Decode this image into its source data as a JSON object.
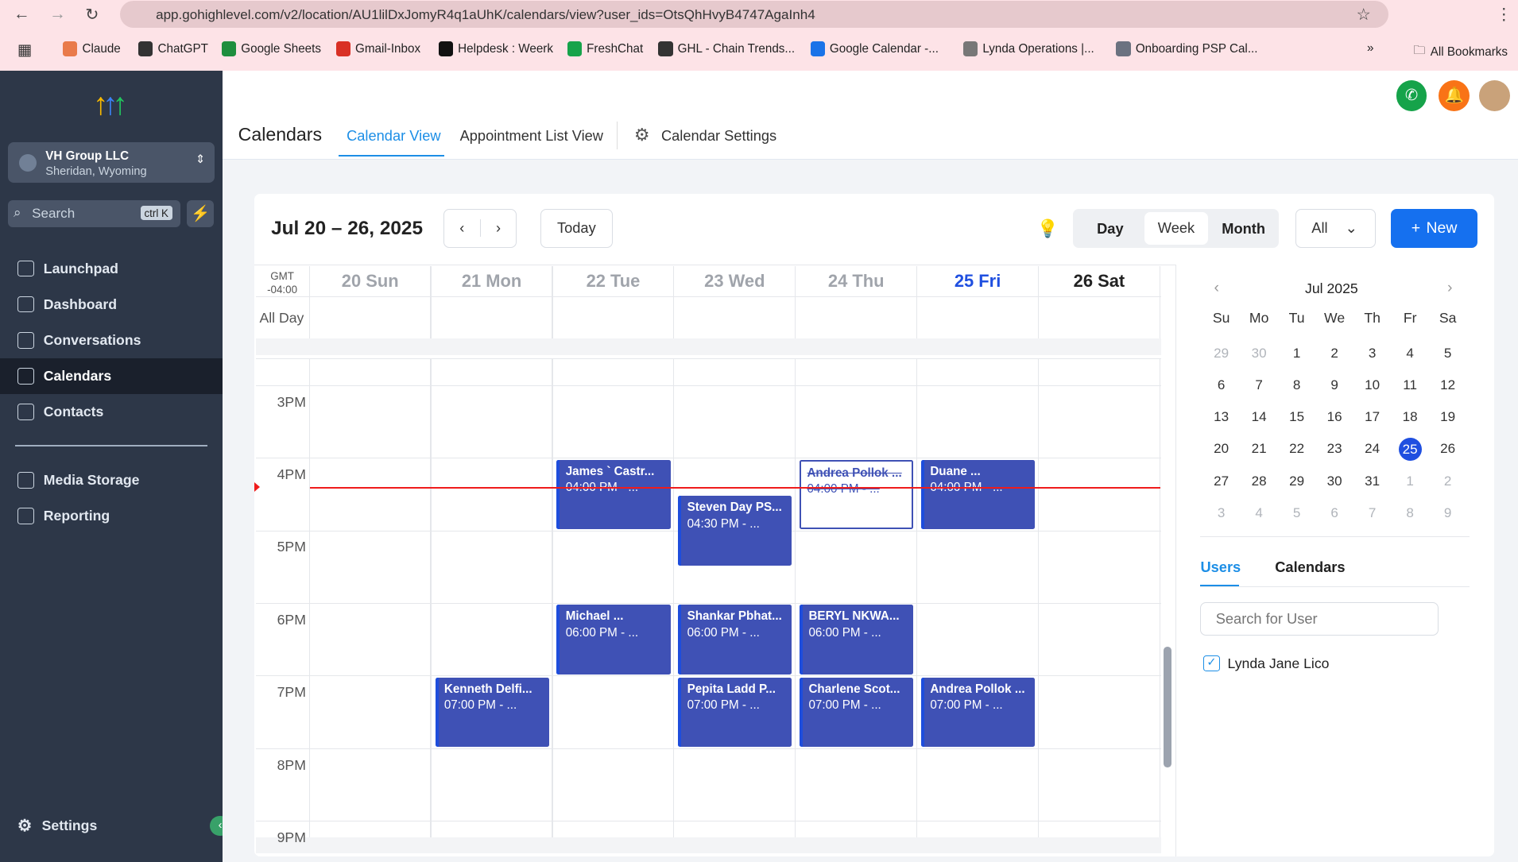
{
  "browser": {
    "url": "app.gohighlevel.com/v2/location/AU1lilDxJomyR4q1aUhK/calendars/view?user_ids=OtsQhHvyB4747AgaInh4",
    "bookmarks": [
      "Claude",
      "ChatGPT",
      "Google Sheets",
      "Gmail-Inbox",
      "Helpdesk : Weerk",
      "FreshChat",
      "GHL - Chain Trends...",
      "Google Calendar -...",
      "Lynda Operations |...",
      "Onboarding PSP Cal..."
    ],
    "all_bookmarks": "All Bookmarks"
  },
  "sidebar": {
    "org_name": "VH Group LLC",
    "org_location": "Sheridan, Wyoming",
    "search_placeholder": "Search",
    "search_shortcut": "ctrl K",
    "items": [
      {
        "label": "Launchpad"
      },
      {
        "label": "Dashboard"
      },
      {
        "label": "Conversations"
      },
      {
        "label": "Calendars"
      },
      {
        "label": "Contacts"
      },
      {
        "label": "Media Storage"
      },
      {
        "label": "Reporting"
      }
    ],
    "settings": "Settings"
  },
  "header": {
    "title": "Calendars",
    "tabs": [
      "Calendar View",
      "Appointment List View",
      "Calendar Settings"
    ]
  },
  "toolbar": {
    "range": "Jul 20 – 26, 2025",
    "today": "Today",
    "views": [
      "Day",
      "Week",
      "Month"
    ],
    "active_view": "Week",
    "filter": "All",
    "new": "New"
  },
  "grid": {
    "tz": "GMT",
    "tz_offset": "-04:00",
    "all_day": "All Day",
    "days": [
      "20 Sun",
      "21 Mon",
      "22 Tue",
      "23 Wed",
      "24 Thu",
      "25 Fri",
      "26 Sat"
    ],
    "hours": [
      "3PM",
      "4PM",
      "5PM",
      "6PM",
      "7PM",
      "8PM",
      "9PM"
    ],
    "events": [
      {
        "day": 2,
        "start": 16,
        "title": "James ` Castr...",
        "time": "04:00 PM - ..."
      },
      {
        "day": 3,
        "start": 16.5,
        "title": "Steven Day PS...",
        "time": "04:30 PM - ..."
      },
      {
        "day": 4,
        "start": 16,
        "title": "Andrea Pollok ...",
        "time": "04:00 PM - ...",
        "cancelled": true
      },
      {
        "day": 5,
        "start": 16,
        "title": "Duane ...",
        "time": "04:00 PM - ..."
      },
      {
        "day": 2,
        "start": 18,
        "title": "Michael ...",
        "time": "06:00 PM - ..."
      },
      {
        "day": 3,
        "start": 18,
        "title": "Shankar Pbhat...",
        "time": "06:00 PM - ..."
      },
      {
        "day": 4,
        "start": 18,
        "title": "BERYL NKWA...",
        "time": "06:00 PM - ..."
      },
      {
        "day": 1,
        "start": 19,
        "title": "Kenneth Delfi...",
        "time": "07:00 PM - ..."
      },
      {
        "day": 3,
        "start": 19,
        "title": "Pepita Ladd P...",
        "time": "07:00 PM - ..."
      },
      {
        "day": 4,
        "start": 19,
        "title": "Charlene Scot...",
        "time": "07:00 PM - ..."
      },
      {
        "day": 5,
        "start": 19,
        "title": "Andrea Pollok ...",
        "time": "07:00 PM - ..."
      }
    ],
    "now_hour": 16.4
  },
  "mini_cal": {
    "month": "Jul 2025",
    "weekdays": [
      "Su",
      "Mo",
      "Tu",
      "We",
      "Th",
      "Fr",
      "Sa"
    ],
    "days": [
      "29",
      "30",
      "1",
      "2",
      "3",
      "4",
      "5",
      "6",
      "7",
      "8",
      "9",
      "10",
      "11",
      "12",
      "13",
      "14",
      "15",
      "16",
      "17",
      "18",
      "19",
      "20",
      "21",
      "22",
      "23",
      "24",
      "25",
      "26",
      "27",
      "28",
      "29",
      "30",
      "31",
      "1",
      "2",
      "3",
      "4",
      "5",
      "6",
      "7",
      "8",
      "9"
    ],
    "selected": "25"
  },
  "panel": {
    "tabs": [
      "Users",
      "Calendars"
    ],
    "search_placeholder": "Search for User",
    "users": [
      "Lynda Jane Lico"
    ]
  }
}
